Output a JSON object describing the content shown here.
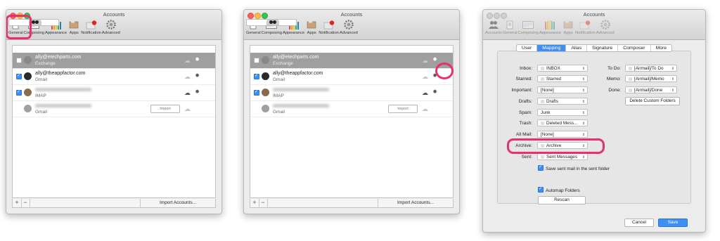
{
  "app_title": "Accounts",
  "toolbar": [
    {
      "label": "Accounts",
      "icon": "accounts-icon"
    },
    {
      "label": "General",
      "icon": "general-icon"
    },
    {
      "label": "Composing",
      "icon": "composing-icon"
    },
    {
      "label": "Appearance",
      "icon": "appearance-icon"
    },
    {
      "label": "Apps",
      "icon": "apps-icon"
    },
    {
      "label": "Notification",
      "icon": "notification-icon"
    },
    {
      "label": "Advanced",
      "icon": "advanced-icon"
    }
  ],
  "accounts": [
    {
      "name": "ally@etechparts.com",
      "type": "Exchange",
      "checked": false
    },
    {
      "name": "ally@theappfactor.com",
      "type": "Gmail",
      "checked": true
    },
    {
      "name": "",
      "type": "IMAP",
      "checked": true
    },
    {
      "name": "",
      "type": "Gmail",
      "checked": false
    }
  ],
  "import_label": "Import",
  "add_label": "+",
  "remove_label": "−",
  "import_accounts_label": "Import Accounts...",
  "tabs": [
    "User",
    "Mapping",
    "Alias",
    "Signature",
    "Composer",
    "More"
  ],
  "active_tab": "Mapping",
  "mapping": [
    {
      "label": "Inbox:",
      "value": "INBOX",
      "checkbox": true
    },
    {
      "label": "Starred:",
      "value": "Starred",
      "checkbox": true
    },
    {
      "label": "Important:",
      "value": "[None]",
      "checkbox": false
    },
    {
      "label": "Drafts:",
      "value": "Drafts",
      "checkbox": true
    },
    {
      "label": "Spam:",
      "value": "Junk",
      "checkbox": false
    },
    {
      "label": "Trash:",
      "value": "Deleted Mess...",
      "checkbox": true
    },
    {
      "label": "All Mail:",
      "value": "[None]",
      "checkbox": false
    },
    {
      "label": "Archive:",
      "value": "Archive",
      "checkbox": true
    },
    {
      "label": "Sent:",
      "value": "Sent Messages",
      "checkbox": true
    }
  ],
  "right_mapping": [
    {
      "label": "To Do:",
      "value": "[Airmail]/To Do"
    },
    {
      "label": "Memo:",
      "value": "[Airmail]/Memo"
    },
    {
      "label": "Done:",
      "value": "[Airmail]/Done"
    }
  ],
  "delete_custom_folders": "Delete Custom Folders",
  "save_sent_label": "Save sent mail in the sent folder",
  "automap_label": "Automap Folders",
  "rescan_label": "Rescan",
  "cancel_label": "Cancel",
  "save_label": "Save",
  "colors": {
    "accent": "#3d8ff5",
    "highlight": "#e8306a"
  }
}
